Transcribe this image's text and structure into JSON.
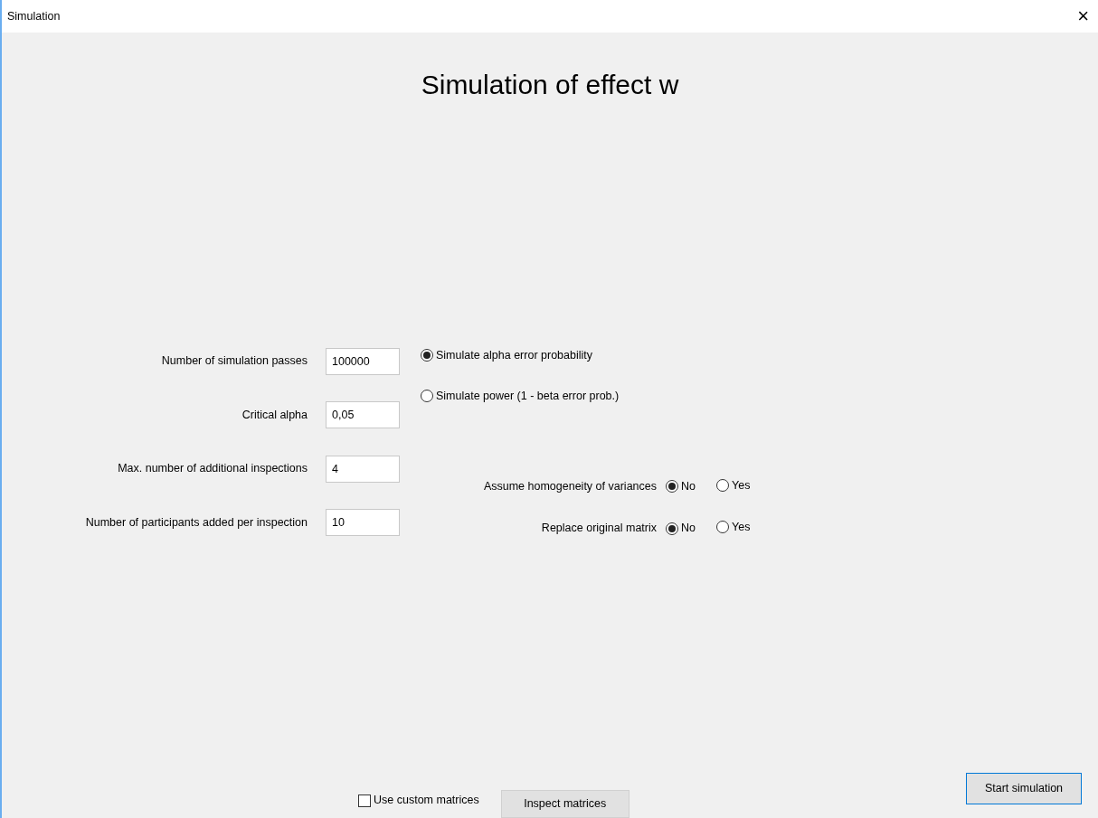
{
  "window": {
    "title": "Simulation",
    "close": "×"
  },
  "heading": "Simulation of effect w",
  "fields": [
    {
      "label": "Number of simulation passes",
      "value": "100000"
    },
    {
      "label": "Critical alpha",
      "value": "0,05"
    },
    {
      "label": "Max. number of additional inspections",
      "value": "4"
    },
    {
      "label": "Number of participants added per inspection",
      "value": "10"
    }
  ],
  "mode_options": [
    {
      "label": "Simulate alpha error probability",
      "selected": true
    },
    {
      "label": "Simulate power (1 - beta error prob.)",
      "selected": false
    }
  ],
  "yes_no_options": [
    {
      "label": "Assume homogeneity of variances",
      "choices": [
        {
          "label": "No",
          "selected": true
        },
        {
          "label": "Yes",
          "selected": false
        }
      ]
    },
    {
      "label": "Replace original matrix",
      "choices": [
        {
          "label": "No",
          "selected": true
        },
        {
          "label": "Yes",
          "selected": false
        }
      ]
    }
  ],
  "custom_matrices": {
    "label": "Use custom matrices",
    "checked": false
  },
  "buttons": {
    "inspect": "Inspect matrices",
    "start": "Start simulation"
  }
}
